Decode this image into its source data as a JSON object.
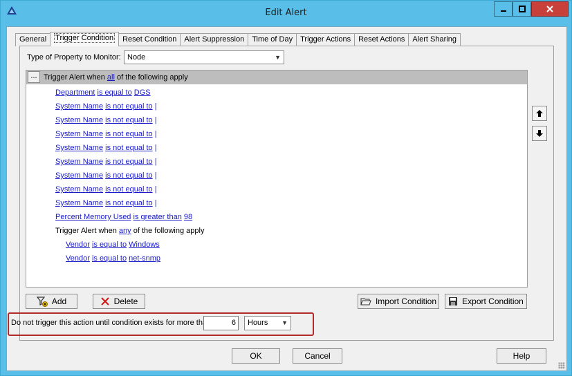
{
  "window": {
    "title": "Edit Alert"
  },
  "tabs": [
    {
      "label": "General"
    },
    {
      "label": "Trigger Condition"
    },
    {
      "label": "Reset Condition"
    },
    {
      "label": "Alert Suppression"
    },
    {
      "label": "Time of Day"
    },
    {
      "label": "Trigger Actions"
    },
    {
      "label": "Reset Actions"
    },
    {
      "label": "Alert Sharing"
    }
  ],
  "property": {
    "label": "Type of Property to Monitor:",
    "value": "Node"
  },
  "tree": {
    "header": {
      "ellipsis": "...",
      "prefix": "Trigger Alert when",
      "mode": "all",
      "suffix": "of the following apply"
    },
    "conditions": [
      {
        "field": "Department",
        "op": "is equal to",
        "value": "DGS"
      },
      {
        "field": "System Name",
        "op": "is not equal to",
        "value": "|"
      },
      {
        "field": "System Name",
        "op": "is not equal to",
        "value": "|"
      },
      {
        "field": "System Name",
        "op": "is not equal to",
        "value": "|"
      },
      {
        "field": "System Name",
        "op": "is not equal to",
        "value": "|"
      },
      {
        "field": "System Name",
        "op": "is not equal to",
        "value": "|"
      },
      {
        "field": "System Name",
        "op": "is not equal to",
        "value": "|"
      },
      {
        "field": "System Name",
        "op": "is not equal to",
        "value": "|"
      },
      {
        "field": "System Name",
        "op": "is not equal to",
        "value": "|"
      },
      {
        "field": "Percent Memory Used",
        "op": "is greater than",
        "value": "98"
      }
    ],
    "subgroup": {
      "prefix": "Trigger Alert when",
      "mode": "any",
      "suffix": "of the following apply"
    },
    "sub_conditions": [
      {
        "field": "Vendor",
        "op": "is equal to",
        "value": "Windows"
      },
      {
        "field": "Vendor",
        "op": "is equal to",
        "value": "net-snmp"
      }
    ]
  },
  "buttons": {
    "add": "Add",
    "delete": "Delete",
    "import": "Import Condition",
    "export": "Export Condition",
    "ok": "OK",
    "cancel": "Cancel",
    "help": "Help"
  },
  "duration": {
    "label": "Do not trigger this action until condition exists for more than",
    "value": "6",
    "unit": "Hours"
  },
  "colors": {
    "title_bar": "#59bfe8",
    "link": "#1a1ac8",
    "highlight_border": "#b22a2a",
    "close_button": "#c7403a"
  }
}
